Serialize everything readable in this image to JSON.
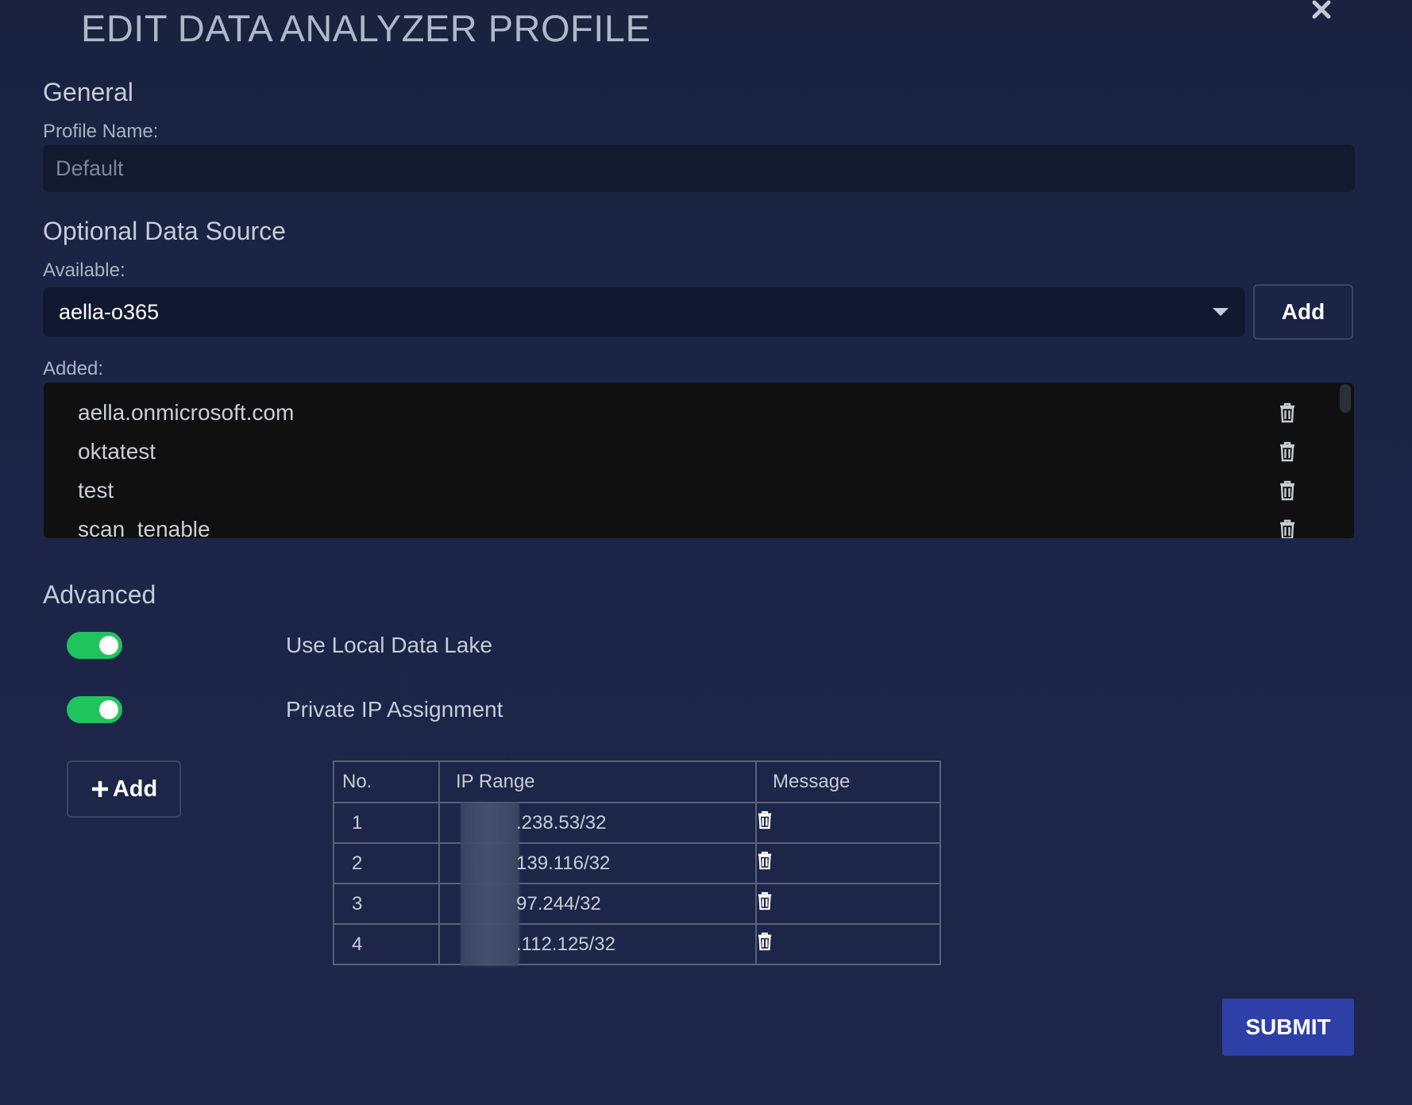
{
  "modal": {
    "title": "EDIT DATA ANALYZER PROFILE"
  },
  "general": {
    "heading": "General",
    "profile_name_label": "Profile Name:",
    "profile_name_placeholder": "Default"
  },
  "data_source": {
    "heading": "Optional Data Source",
    "available_label": "Available:",
    "selected_value": "aella-o365",
    "add_label": "Add",
    "added_label": "Added:",
    "added_items": [
      "aella.onmicrosoft.com",
      "oktatest",
      "test",
      "scan_tenable"
    ]
  },
  "advanced": {
    "heading": "Advanced",
    "toggles": [
      {
        "label": "Use Local Data Lake",
        "on": true
      },
      {
        "label": "Private IP Assignment",
        "on": true
      }
    ],
    "add_label": "Add",
    "table": {
      "headers": [
        "No.",
        "IP Range",
        "Message"
      ],
      "rows": [
        {
          "no": "1",
          "ip_range": ".238.53/32"
        },
        {
          "no": "2",
          "ip_range": "139.116/32"
        },
        {
          "no": "3",
          "ip_range": "97.244/32"
        },
        {
          "no": "4",
          "ip_range": ".112.125/32"
        }
      ]
    }
  },
  "footer": {
    "submit_label": "SUBMIT"
  },
  "colors": {
    "background": "#1b2443",
    "toggle_on": "#1fc45d",
    "submit": "#2f3fa8"
  },
  "icons": {
    "close": "close-icon",
    "dropdown": "chevron-down-icon",
    "delete": "trash-icon",
    "add": "plus-icon"
  }
}
